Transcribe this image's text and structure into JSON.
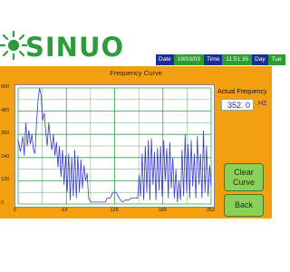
{
  "brand": {
    "logo_text": "SINUO"
  },
  "status": {
    "date_label": "Date",
    "date_value": "19/03/03",
    "time_label": "Time",
    "time_value": "11:51:35",
    "day_label": "Day",
    "day_value": "Tue"
  },
  "screen": {
    "title": "Frequency Curve",
    "actual_frequency_label": "Actual Frequency",
    "actual_frequency_value": "352. 0",
    "actual_frequency_unit": "HZ",
    "clear_curve_label_line1": "Clear",
    "clear_curve_label_line2": "Curve",
    "back_label": "Back"
  },
  "colors": {
    "panel": "#f2a012",
    "plot_line": "#3a3ad0",
    "grid": "#35a04a",
    "button": "#8ad05a",
    "status_label": "#1a2e9a",
    "status_value": "#2e9b33"
  },
  "chart_data": {
    "type": "line",
    "title": "Frequency Curve",
    "xlabel": "",
    "ylabel": "",
    "x_ticks": [
      "0",
      "63",
      "126",
      "189",
      "252"
    ],
    "y_ticks": [
      "600",
      "480",
      "360",
      "240",
      "120",
      "0"
    ],
    "xlim": [
      0,
      252
    ],
    "ylim": [
      0,
      600
    ],
    "grid": true,
    "series": [
      {
        "values": [
          [
            0,
            330
          ],
          [
            3,
            270
          ],
          [
            6,
            350
          ],
          [
            8,
            250
          ],
          [
            10,
            420
          ],
          [
            12,
            300
          ],
          [
            14,
            380
          ],
          [
            16,
            310
          ],
          [
            18,
            360
          ],
          [
            20,
            280
          ],
          [
            22,
            260
          ],
          [
            24,
            420
          ],
          [
            26,
            540
          ],
          [
            28,
            600
          ],
          [
            30,
            560
          ],
          [
            32,
            430
          ],
          [
            34,
            470
          ],
          [
            36,
            380
          ],
          [
            38,
            300
          ],
          [
            40,
            420
          ],
          [
            42,
            340
          ],
          [
            44,
            280
          ],
          [
            46,
            360
          ],
          [
            48,
            250
          ],
          [
            50,
            320
          ],
          [
            52,
            190
          ],
          [
            54,
            300
          ],
          [
            56,
            140
          ],
          [
            58,
            280
          ],
          [
            60,
            100
          ],
          [
            62,
            250
          ],
          [
            64,
            60
          ],
          [
            66,
            260
          ],
          [
            68,
            20
          ],
          [
            70,
            240
          ],
          [
            72,
            40
          ],
          [
            74,
            280
          ],
          [
            76,
            30
          ],
          [
            78,
            250
          ],
          [
            80,
            60
          ],
          [
            82,
            230
          ],
          [
            84,
            80
          ],
          [
            86,
            200
          ],
          [
            88,
            120
          ],
          [
            90,
            160
          ],
          [
            92,
            30
          ],
          [
            95,
            10
          ],
          [
            100,
            10
          ],
          [
            105,
            10
          ],
          [
            110,
            10
          ],
          [
            114,
            10
          ],
          [
            116,
            30
          ],
          [
            120,
            30
          ],
          [
            124,
            60
          ],
          [
            128,
            60
          ],
          [
            132,
            30
          ],
          [
            136,
            10
          ],
          [
            140,
            20
          ],
          [
            144,
            20
          ],
          [
            148,
            30
          ],
          [
            152,
            30
          ],
          [
            156,
            30
          ],
          [
            158,
            150
          ],
          [
            160,
            40
          ],
          [
            162,
            260
          ],
          [
            164,
            20
          ],
          [
            166,
            300
          ],
          [
            168,
            60
          ],
          [
            170,
            330
          ],
          [
            172,
            20
          ],
          [
            174,
            340
          ],
          [
            176,
            100
          ],
          [
            178,
            270
          ],
          [
            180,
            20
          ],
          [
            182,
            290
          ],
          [
            184,
            70
          ],
          [
            186,
            300
          ],
          [
            188,
            40
          ],
          [
            190,
            330
          ],
          [
            192,
            120
          ],
          [
            194,
            290
          ],
          [
            196,
            30
          ],
          [
            198,
            320
          ],
          [
            200,
            80
          ],
          [
            202,
            240
          ],
          [
            204,
            30
          ],
          [
            206,
            180
          ],
          [
            208,
            10
          ],
          [
            210,
            120
          ],
          [
            212,
            20
          ],
          [
            214,
            280
          ],
          [
            216,
            40
          ],
          [
            218,
            360
          ],
          [
            220,
            60
          ],
          [
            222,
            310
          ],
          [
            224,
            30
          ],
          [
            226,
            330
          ],
          [
            228,
            90
          ],
          [
            230,
            260
          ],
          [
            232,
            30
          ],
          [
            234,
            350
          ],
          [
            236,
            100
          ],
          [
            238,
            260
          ],
          [
            240,
            30
          ],
          [
            242,
            380
          ],
          [
            244,
            60
          ],
          [
            246,
            300
          ],
          [
            248,
            40
          ],
          [
            250,
            200
          ],
          [
            252,
            90
          ]
        ]
      }
    ]
  }
}
